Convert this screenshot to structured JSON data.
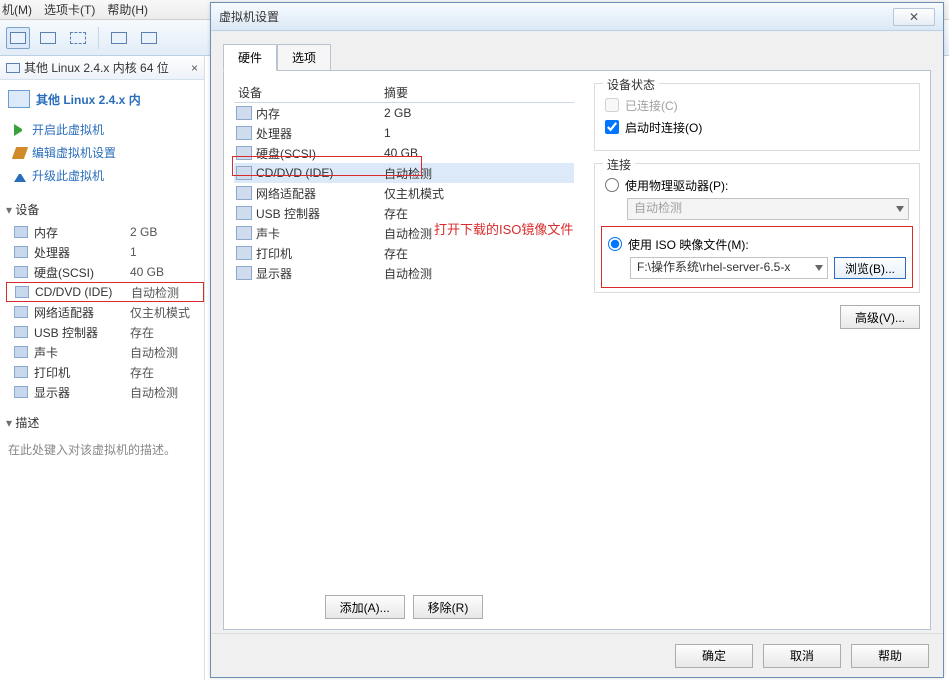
{
  "menubar": {
    "vm": "机(M)",
    "tabs": "选项卡(T)",
    "help": "帮助(H)"
  },
  "left": {
    "tab_title": "其他 Linux 2.4.x 内核 64 位",
    "vm_title": "其他 Linux 2.4.x 内",
    "actions": {
      "power_on": "开启此虚拟机",
      "edit": "编辑虚拟机设置",
      "upgrade": "升级此虚拟机"
    },
    "section_devices": "设备",
    "devices": [
      {
        "name": "内存",
        "value": "2 GB"
      },
      {
        "name": "处理器",
        "value": "1"
      },
      {
        "name": "硬盘(SCSI)",
        "value": "40 GB"
      },
      {
        "name": "CD/DVD (IDE)",
        "value": "自动检测"
      },
      {
        "name": "网络适配器",
        "value": "仅主机模式"
      },
      {
        "name": "USB 控制器",
        "value": "存在"
      },
      {
        "name": "声卡",
        "value": "自动检测"
      },
      {
        "name": "打印机",
        "value": "存在"
      },
      {
        "name": "显示器",
        "value": "自动检测"
      }
    ],
    "section_desc": "描述",
    "desc_hint": "在此处键入对该虚拟机的描述。"
  },
  "dialog": {
    "title": "虚拟机设置",
    "tabs": {
      "hardware": "硬件",
      "options": "选项"
    },
    "hw_header": {
      "device": "设备",
      "summary": "摘要"
    },
    "hw_rows": [
      {
        "name": "内存",
        "value": "2 GB"
      },
      {
        "name": "处理器",
        "value": "1"
      },
      {
        "name": "硬盘(SCSI)",
        "value": "40 GB"
      },
      {
        "name": "CD/DVD (IDE)",
        "value": "自动检测"
      },
      {
        "name": "网络适配器",
        "value": "仅主机模式"
      },
      {
        "name": "USB 控制器",
        "value": "存在"
      },
      {
        "name": "声卡",
        "value": "自动检测"
      },
      {
        "name": "打印机",
        "value": "存在"
      },
      {
        "name": "显示器",
        "value": "自动检测"
      }
    ],
    "buttons": {
      "add": "添加(A)...",
      "remove": "移除(R)"
    },
    "right": {
      "state_legend": "设备状态",
      "connected": "已连接(C)",
      "connect_on_start": "启动时连接(O)",
      "conn_legend": "连接",
      "use_physical": "使用物理驱动器(P):",
      "auto_detect": "自动检测",
      "use_iso": "使用 ISO 映像文件(M):",
      "iso_path": "F:\\操作系统\\rhel-server-6.5-x",
      "browse": "浏览(B)...",
      "advanced": "高级(V)..."
    },
    "annotation": "打开下载的ISO镜像文件",
    "bottom": {
      "ok": "确定",
      "cancel": "取消",
      "help": "帮助"
    }
  }
}
